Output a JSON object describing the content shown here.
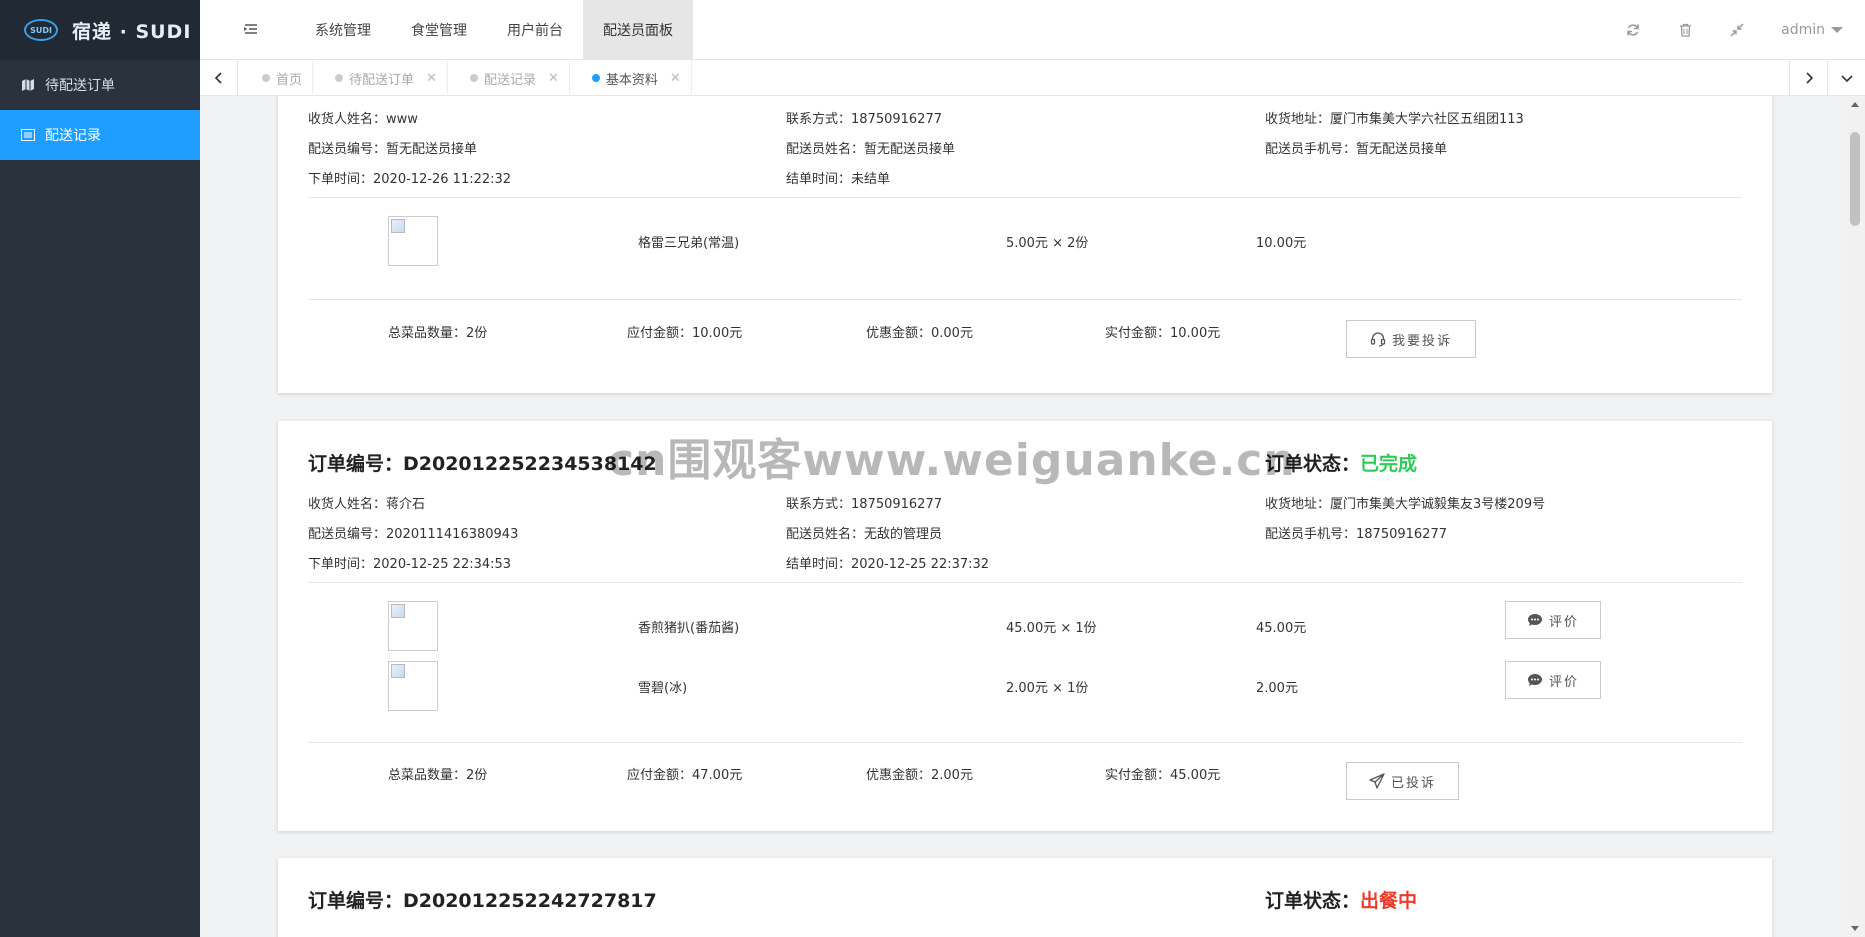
{
  "logo": {
    "badge": "SUDI",
    "text": "宿递 · SUDI"
  },
  "sidebar": {
    "items": [
      {
        "label": "待配送订单"
      },
      {
        "label": "配送记录"
      }
    ]
  },
  "topnav": {
    "items": [
      {
        "label": "系统管理"
      },
      {
        "label": "食堂管理"
      },
      {
        "label": "用户前台"
      },
      {
        "label": "配送员面板"
      }
    ],
    "user": "admin"
  },
  "tabs": [
    {
      "label": "首页"
    },
    {
      "label": "待配送订单"
    },
    {
      "label": "配送记录"
    },
    {
      "label": "基本资料"
    }
  ],
  "orders": [
    {
      "receiver": "收货人姓名：www",
      "contact": "联系方式：18750916277",
      "address": "收货地址：厦门市集美大学六社区五组团113",
      "courier_no": "配送员编号：暂无配送员接单",
      "courier_name": "配送员姓名：暂无配送员接单",
      "courier_phone": "配送员手机号：暂无配送员接单",
      "order_time": "下单时间：2020-12-26 11:22:32",
      "close_time": "结单时间：未结单",
      "items": [
        {
          "name": "格雷三兄弟(常温)",
          "price_qty": "5.00元 × 2份",
          "subtotal": "10.00元"
        }
      ],
      "total_qty": "总菜品数量：2份",
      "payable": "应付金额：10.00元",
      "discount": "优惠金额：0.00元",
      "paid": "实付金额：10.00元",
      "complaint_btn": "我要投诉"
    },
    {
      "title": "订单编号：D202012252234538142",
      "status_label": "订单状态：",
      "status": "已完成",
      "receiver": "收货人姓名：蒋介石",
      "contact": "联系方式：18750916277",
      "address": "收货地址：厦门市集美大学诚毅集友3号楼209号",
      "courier_no": "配送员编号：2020111416380943",
      "courier_name": "配送员姓名：无敌的管理员",
      "courier_phone": "配送员手机号：18750916277",
      "order_time": "下单时间：2020-12-25 22:34:53",
      "close_time": "结单时间：2020-12-25 22:37:32",
      "items": [
        {
          "name": "香煎猪扒(番茄酱)",
          "price_qty": "45.00元 × 1份",
          "subtotal": "45.00元",
          "review_btn": "评价"
        },
        {
          "name": "雪碧(冰)",
          "price_qty": "2.00元 × 1份",
          "subtotal": "2.00元",
          "review_btn": "评价"
        }
      ],
      "total_qty": "总菜品数量：2份",
      "payable": "应付金额：47.00元",
      "discount": "优惠金额：2.00元",
      "paid": "实付金额：45.00元",
      "complaint_btn": "已投诉"
    },
    {
      "title": "订单编号：D202012252242727817",
      "status_label": "订单状态：",
      "status": "出餐中"
    }
  ],
  "watermark": "cn围观客www.weiguanke.cn",
  "colors": {
    "sidebar": "#2a323e",
    "active": "#1e9fff",
    "done": "#2ecc57",
    "cooking": "#ee3b2b"
  }
}
